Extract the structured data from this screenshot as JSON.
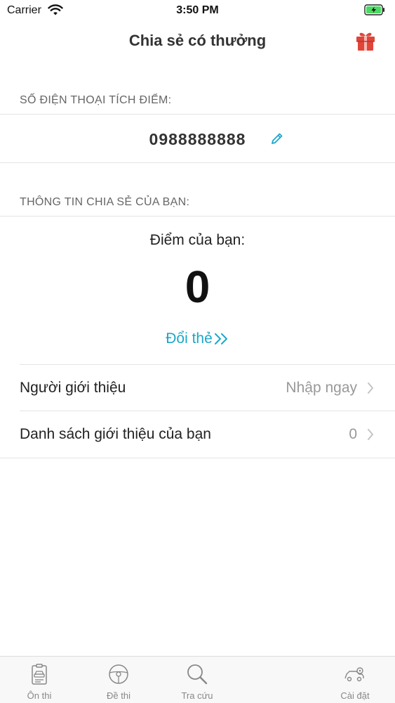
{
  "status_bar": {
    "carrier": "Carrier",
    "time": "3:50 PM"
  },
  "nav": {
    "title": "Chia sẻ có thưởng",
    "gift_icon": "gift-icon"
  },
  "phone_section": {
    "header": "SỐ ĐIỆN THOẠI TÍCH ĐIỂM:",
    "phone": "0988888888",
    "edit_icon": "pencil-icon"
  },
  "share_section": {
    "header": "THÔNG TIN CHIA SẺ CỦA BẠN:",
    "points_label": "Điểm của bạn:",
    "points_value": "0",
    "redeem_label": "Đổi thẻ"
  },
  "rows": [
    {
      "label": "Người giới thiệu",
      "value": "Nhập ngay"
    },
    {
      "label": "Danh sách giới thiệu của bạn",
      "value": "0"
    }
  ],
  "tabs": [
    {
      "label": "Ôn thi",
      "icon": "clipboard-car-icon"
    },
    {
      "label": "Đề thi",
      "icon": "steering-wheel-icon"
    },
    {
      "label": "Tra cứu",
      "icon": "search-icon"
    },
    {
      "label": "Cài đặt",
      "icon": "car-settings-icon"
    }
  ],
  "colors": {
    "accent": "#1ba8c9",
    "gift": "#e0453a",
    "secondary_text": "#999999"
  }
}
